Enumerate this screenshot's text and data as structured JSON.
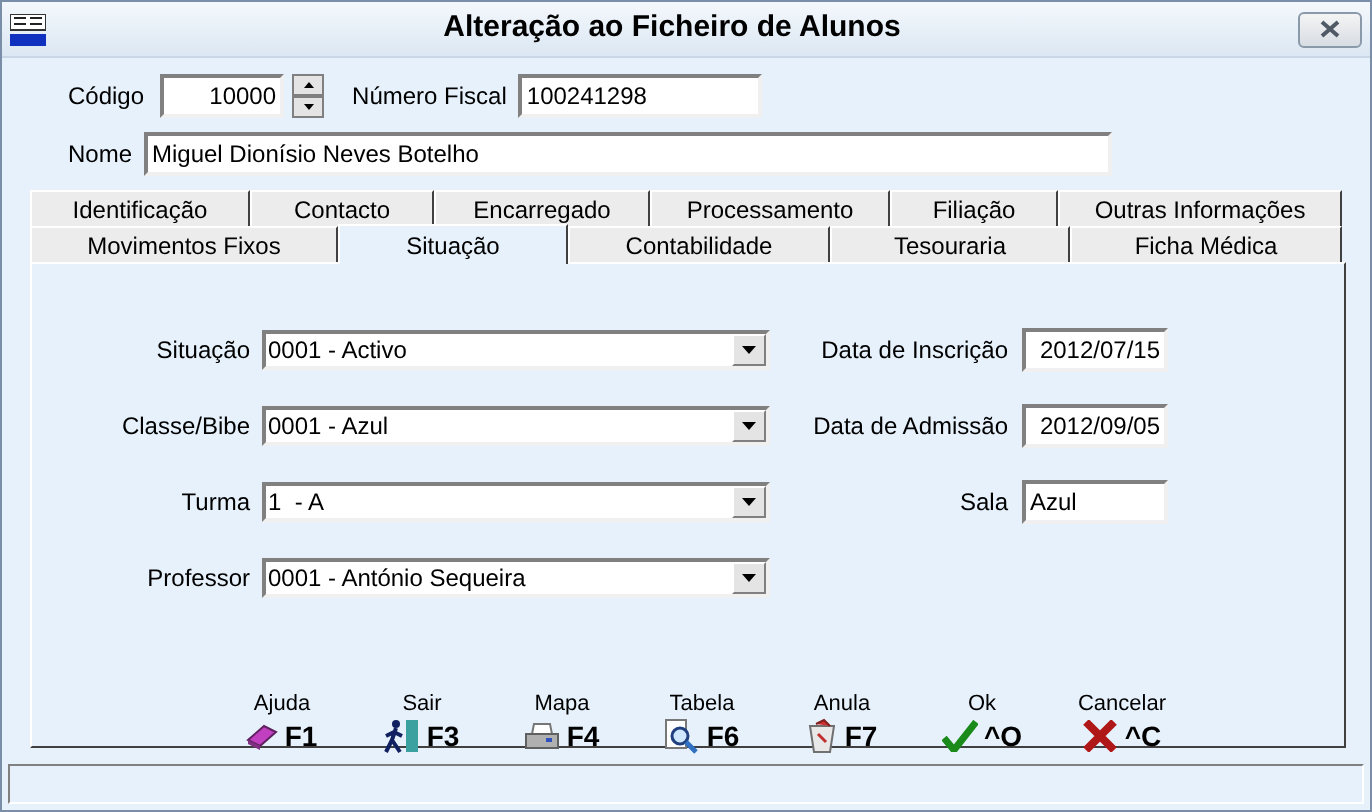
{
  "window": {
    "title": "Alteração ao Ficheiro de Alunos"
  },
  "header": {
    "codigo": {
      "label": "Código",
      "value": "10000"
    },
    "fiscal": {
      "label": "Número Fiscal",
      "value": "100241298"
    },
    "nome": {
      "label": "Nome",
      "value": "Miguel Dionísio Neves Botelho"
    }
  },
  "tab_rows": [
    [
      {
        "label": "Identificação",
        "selected": false
      },
      {
        "label": "Contacto",
        "selected": false
      },
      {
        "label": "Encarregado",
        "selected": false
      },
      {
        "label": "Processamento",
        "selected": false
      },
      {
        "label": "Filiação",
        "selected": false
      },
      {
        "label": "Outras Informações",
        "selected": false
      }
    ],
    [
      {
        "label": "Movimentos Fixos",
        "selected": false
      },
      {
        "label": "Situação",
        "selected": true
      },
      {
        "label": "Contabilidade",
        "selected": false
      },
      {
        "label": "Tesouraria",
        "selected": false
      },
      {
        "label": "Ficha Médica",
        "selected": false
      }
    ]
  ],
  "left_fields": [
    {
      "label": "Situação",
      "value": "0001 - Activo"
    },
    {
      "label": "Classe/Bibe",
      "value": "0001 - Azul"
    },
    {
      "label": "Turma",
      "value": "1  - A"
    },
    {
      "label": "Professor",
      "value": "0001 - António Sequeira"
    }
  ],
  "right_fields": [
    {
      "label": "Data de Inscrição",
      "value": "2012/07/15"
    },
    {
      "label": "Data de Admissão",
      "value": "2012/09/05"
    },
    {
      "label": "Sala",
      "value": "Azul"
    }
  ],
  "buttons": [
    {
      "label": "Ajuda",
      "key": "F1"
    },
    {
      "label": "Sair",
      "key": "F3"
    },
    {
      "label": "Mapa",
      "key": "F4"
    },
    {
      "label": "Tabela",
      "key": "F6"
    },
    {
      "label": "Anula",
      "key": "F7"
    },
    {
      "label": "Ok",
      "key": "^O"
    },
    {
      "label": "Cancelar",
      "key": "^C"
    }
  ]
}
